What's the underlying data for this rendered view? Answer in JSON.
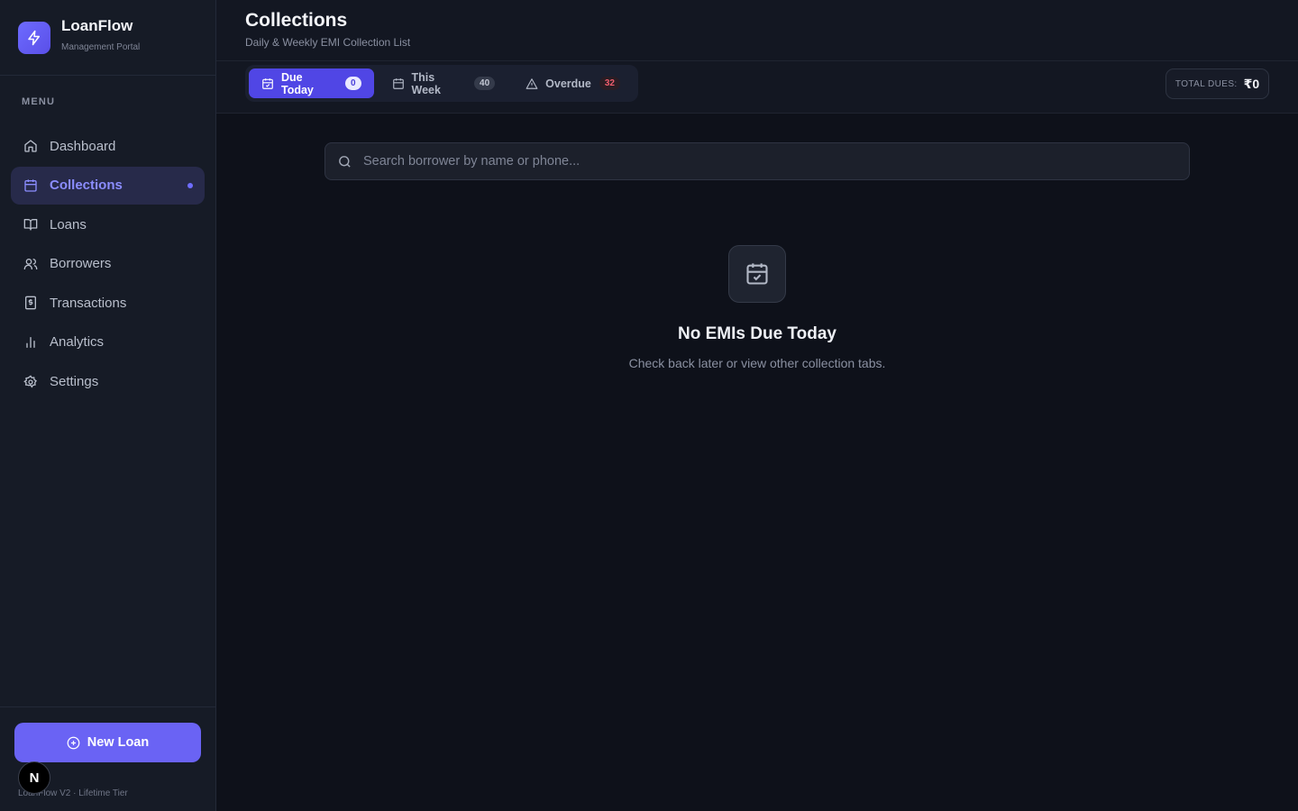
{
  "brand": {
    "name": "LoanFlow",
    "subtitle": "Management Portal"
  },
  "sidebar": {
    "menu_label": "MENU",
    "items": [
      {
        "label": "Dashboard",
        "icon": "home-icon",
        "active": false
      },
      {
        "label": "Collections",
        "icon": "calendar-icon",
        "active": true
      },
      {
        "label": "Loans",
        "icon": "book-icon",
        "active": false
      },
      {
        "label": "Borrowers",
        "icon": "users-icon",
        "active": false
      },
      {
        "label": "Transactions",
        "icon": "receipt-icon",
        "active": false
      },
      {
        "label": "Analytics",
        "icon": "bar-chart-icon",
        "active": false
      },
      {
        "label": "Settings",
        "icon": "gear-icon",
        "active": false
      }
    ],
    "new_loan_label": "New Loan",
    "version": "LoanFlow V2 · Lifetime Tier",
    "badge_letter": "N"
  },
  "header": {
    "title": "Collections",
    "subtitle": "Daily & Weekly EMI Collection List"
  },
  "tabs": [
    {
      "label": "Due Today",
      "count": "0",
      "icon": "calendar-check-icon"
    },
    {
      "label": "This Week",
      "count": "40",
      "icon": "calendar-icon"
    },
    {
      "label": "Overdue",
      "count": "32",
      "icon": "warning-triangle-icon"
    }
  ],
  "total": {
    "label": "TOTAL DUES:",
    "value": "₹0"
  },
  "search": {
    "placeholder": "Search borrower by name or phone...",
    "value": ""
  },
  "empty_state": {
    "icon": "calendar-check-icon",
    "title": "No EMIs Due Today",
    "subtitle": "Check back later or view other collection tabs."
  },
  "colors": {
    "accent": "#5046e5",
    "active_nav_text": "#8b8dff",
    "overdue_red": "#f05d6c",
    "background": "#0e111a"
  }
}
